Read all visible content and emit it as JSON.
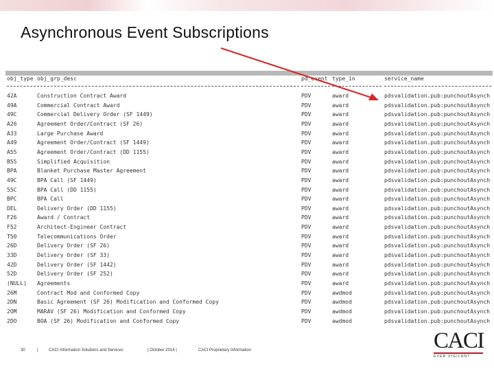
{
  "slide": {
    "title": "Asynchronous Event Subscriptions"
  },
  "table": {
    "columns": [
      "obj_type",
      "obj_grp_desc",
      "pd_event",
      "type_in",
      "service_name"
    ],
    "rows": [
      [
        "42A",
        "Construction Contract Award",
        "PDV",
        "award",
        "pdsvalidation.pub:punchoutAsynch"
      ],
      [
        "49A",
        "Commercial Contract Award",
        "PDV",
        "award",
        "pdsvalidation.pub:punchoutAsynch"
      ],
      [
        "49C",
        "Commercial Delivery Order (SF 1449)",
        "PDV",
        "award",
        "pdsvalidation.pub:punchoutAsynch"
      ],
      [
        "A26",
        "Agreement Order/Contract (SF 26)",
        "PDV",
        "award",
        "pdsvalidation.pub:punchoutAsynch"
      ],
      [
        "A33",
        "Large Purchase Award",
        "PDV",
        "award",
        "pdsvalidation.pub:punchoutAsynch"
      ],
      [
        "A49",
        "Agreement Order/Contract (SF 1449)",
        "PDV",
        "award",
        "pdsvalidation.pub:punchoutAsynch"
      ],
      [
        "A55",
        "Agreement Order/Contract (DD 1155)",
        "PDV",
        "award",
        "pdsvalidation.pub:punchoutAsynch"
      ],
      [
        "B55",
        "Simplified Acquisition",
        "PDV",
        "award",
        "pdsvalidation.pub:punchoutAsynch"
      ],
      [
        "BPA",
        "Blanket Purchase Master Agreement",
        "PDV",
        "award",
        "pdsvalidation.pub:punchoutAsynch"
      ],
      [
        "49C",
        "BPA Call (SF 1449)",
        "PDV",
        "award",
        "pdsvalidation.pub:punchoutAsynch"
      ],
      [
        "55C",
        "BPA Call (DD 1155)",
        "PDV",
        "award",
        "pdsvalidation.pub:punchoutAsynch"
      ],
      [
        "BPC",
        "BPA Call",
        "PDV",
        "award",
        "pdsvalidation.pub:punchoutAsynch"
      ],
      [
        "DEL",
        "Delivery Order (DD 1155)",
        "PDV",
        "award",
        "pdsvalidation.pub:punchoutAsynch"
      ],
      [
        "F26",
        "Award / Contract",
        "PDV",
        "award",
        "pdsvalidation.pub:punchoutAsynch"
      ],
      [
        "F52",
        "Architect-Engineer Contract",
        "PDV",
        "award",
        "pdsvalidation.pub:punchoutAsynch"
      ],
      [
        "T50",
        "Telecommunications Order",
        "PDV",
        "award",
        "pdsvalidation.pub:punchoutAsynch"
      ],
      [
        "26D",
        "Delivery Order (SF 26)",
        "PDV",
        "award",
        "pdsvalidation.pub:punchoutAsynch"
      ],
      [
        "33D",
        "Delivery Order (SF 33)",
        "PDV",
        "award",
        "pdsvalidation.pub:punchoutAsynch"
      ],
      [
        "42D",
        "Delivery Order (SF 1442)",
        "PDV",
        "award",
        "pdsvalidation.pub:punchoutAsynch"
      ],
      [
        "52D",
        "Delivery Order (SF 252)",
        "PDV",
        "award",
        "pdsvalidation.pub:punchoutAsynch"
      ],
      [
        "(NULL)",
        "Agreements",
        "PDV",
        "award",
        "pdsvalidation.pub:punchoutAsynch"
      ],
      [
        "26M",
        "Contract Mod and Conformed Copy",
        "PDV",
        "awdmod",
        "pdsvalidation.pub:punchoutAsynch"
      ],
      [
        "2DN",
        "Basic Agreement (SF 26) Modification and Conformed Copy",
        "PDV",
        "awdmod",
        "pdsvalidation.pub:punchoutAsynch"
      ],
      [
        "2OM",
        "MARAV (SF 26) Modification and Conformed Copy",
        "PDV",
        "awdmod",
        "pdsvalidation.pub:punchoutAsynch"
      ],
      [
        "2DO",
        "BOA (SF 26) Modification and Conformed Copy",
        "PDV",
        "awdmod",
        "pdsvalidation.pub:punchoutAsynch"
      ]
    ]
  },
  "footer": {
    "page_number": "30",
    "sep1": "|",
    "company": "CACI Information Solutions and Services",
    "date": "| October 2014 |",
    "classification": "CACI Proprietary Information"
  },
  "logo": {
    "name": "CACI",
    "tagline": "EVER VIGILANT"
  },
  "colors": {
    "accent_red": "#d42a2a",
    "brand_red": "#b01c2e",
    "header_bar": "#b8b8b8"
  }
}
